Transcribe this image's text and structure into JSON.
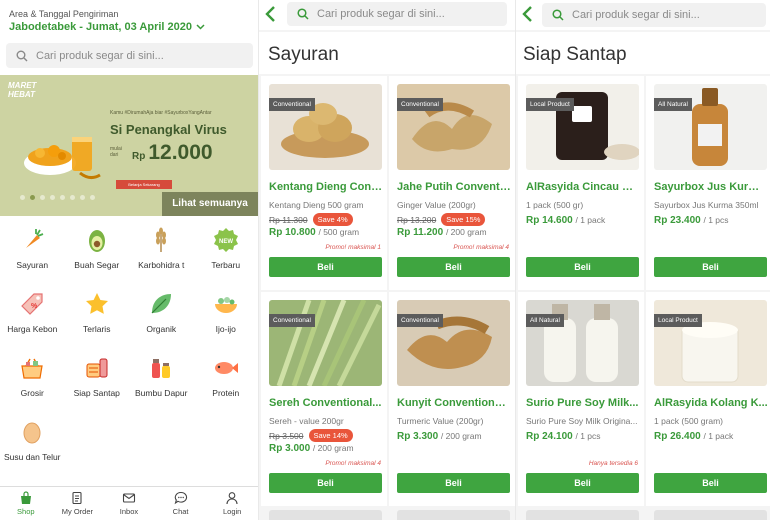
{
  "home": {
    "area_label": "Area & Tanggal Pengiriman",
    "area_value": "Jabodetabek - Jumat, 03 April 2020",
    "search_placeholder": "Cari produk segar di sini...",
    "banner": {
      "logo": "MARET HEBAT",
      "tagline": "Kamu #DirumahAja biar #SayurboxYangAntar",
      "headline": "Si Penangkal Virus",
      "mulai": "mulai dari",
      "currency": "Rp",
      "price": "12.000",
      "cta": "Belanja Sekarang",
      "see_all": "Lihat semuanya",
      "slide_count": 8,
      "active_slide": 1
    },
    "categories": [
      {
        "label": "Sayuran",
        "icon": "carrot-icon"
      },
      {
        "label": "Buah Segar",
        "icon": "avocado-icon"
      },
      {
        "label": "Karbohidra t",
        "icon": "wheat-icon"
      },
      {
        "label": "Terbaru",
        "icon": "new-badge-icon"
      },
      {
        "label": "Harga Kebon",
        "icon": "price-tag-icon"
      },
      {
        "label": "Terlaris",
        "icon": "star-icon"
      },
      {
        "label": "Organik",
        "icon": "leaf-icon"
      },
      {
        "label": "Ijo-ijo",
        "icon": "salad-bowl-icon"
      },
      {
        "label": "Grosir",
        "icon": "basket-icon"
      },
      {
        "label": "Siap Santap",
        "icon": "ready-meal-icon"
      },
      {
        "label": "Bumbu Dapur",
        "icon": "spice-bottle-icon"
      },
      {
        "label": "Protein",
        "icon": "fish-icon"
      },
      {
        "label": "Susu dan Telur",
        "icon": "egg-icon"
      }
    ],
    "nav": [
      {
        "label": "Shop",
        "icon": "shop-bag-icon",
        "active": true
      },
      {
        "label": "My Order",
        "icon": "order-list-icon",
        "active": false
      },
      {
        "label": "Inbox",
        "icon": "envelope-icon",
        "active": false
      },
      {
        "label": "Chat",
        "icon": "chat-bubble-icon",
        "active": false
      },
      {
        "label": "Login",
        "icon": "user-icon",
        "active": false
      }
    ]
  },
  "sayuran": {
    "search_placeholder": "Cari produk segar di sini...",
    "title": "Sayuran",
    "products": [
      {
        "badge": "Conventional",
        "name": "Kentang Dieng Conv...",
        "sub": "Kentang Dieng 500 gram",
        "old_price": "Rp 11.300",
        "save": "Save 4%",
        "price": "Rp 10.800",
        "unit": "/ 500 gram",
        "promo": "Promo! maksimal 1",
        "buy": "Beli"
      },
      {
        "badge": "Conventional",
        "name": "Jahe Putih Conventi...",
        "sub": "Ginger Value (200gr)",
        "old_price": "Rp 13.200",
        "save": "Save 15%",
        "price": "Rp 11.200",
        "unit": "/ 200 gram",
        "promo": "Promo! maksimal 4",
        "buy": "Beli"
      },
      {
        "badge": "Conventional",
        "name": "Sereh Conventional...",
        "sub": "Sereh - value 200gr",
        "old_price": "Rp 3.500",
        "save": "Save 14%",
        "price": "Rp 3.000",
        "unit": "/ 200 gram",
        "promo": "Promo! maksimal 4",
        "buy": "Beli"
      },
      {
        "badge": "Conventional",
        "name": "Kunyit Conventional...",
        "sub": "Turmeric Value (200gr)",
        "old_price": "",
        "save": "",
        "price": "Rp 3.300",
        "unit": "/ 200 gram",
        "promo": "",
        "buy": "Beli"
      }
    ]
  },
  "siap_santap": {
    "search_placeholder": "Cari produk segar di sini...",
    "title": "Siap Santap",
    "products": [
      {
        "badge": "Local Product",
        "name": "AlRasyida Cincau Hi...",
        "sub": "1 pack (500 gr)",
        "old_price": "",
        "save": "",
        "price": "Rp 14.600",
        "unit": "/ 1 pack",
        "promo": "",
        "buy": "Beli"
      },
      {
        "badge": "All Natural",
        "name": "Sayurbox Jus Kurma...",
        "sub": "Sayurbox Jus Kurma 350ml",
        "old_price": "",
        "save": "",
        "price": "Rp 23.400",
        "unit": "/ 1 pcs",
        "promo": "",
        "buy": "Beli"
      },
      {
        "badge": "All Natural",
        "name": "Surio Pure Soy Milk...",
        "sub": "Surio Pure Soy Milk Origina...",
        "old_price": "",
        "save": "",
        "price": "Rp 24.100",
        "unit": "/ 1 pcs",
        "promo": "Hanya tersedia 6",
        "buy": "Beli"
      },
      {
        "badge": "Local Product",
        "name": "AlRasyida Kolang K...",
        "sub": "1 pack (500 gram)",
        "old_price": "",
        "save": "",
        "price": "Rp 26.400",
        "unit": "/ 1 pack",
        "promo": "",
        "buy": "Beli"
      }
    ]
  },
  "colors": {
    "brand_green": "#3a9a3a",
    "button_green": "#3fa540",
    "save_red": "#e9553b"
  }
}
